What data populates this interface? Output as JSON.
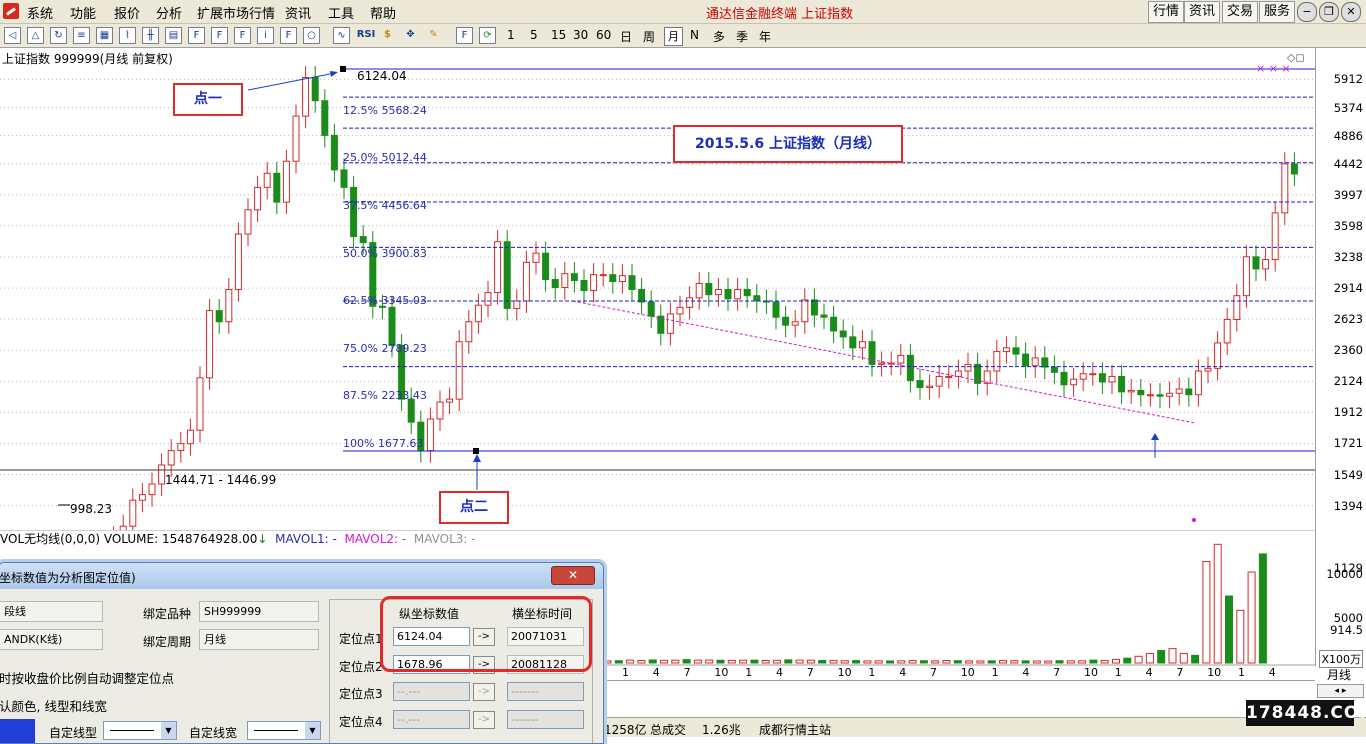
{
  "menubar": {
    "items": [
      "系统",
      "功能",
      "报价",
      "分析",
      "扩展市场行情",
      "资讯",
      "工具",
      "帮助"
    ],
    "app_title": "通达信金融终端   上证指数",
    "right_buttons": [
      "行情",
      "资讯",
      "交易",
      "服务"
    ]
  },
  "toolbar": {
    "icons": [
      "back-icon",
      "up-icon",
      "refresh-icon",
      "list-icon",
      "grid-icon",
      "line-chart-icon",
      "kline-icon",
      "report-icon",
      "f10-icon",
      "f11-icon",
      "fiz-icon",
      "info-icon",
      "search-icon",
      "wave-icon",
      "rsi-icon",
      "money-icon",
      "move-icon",
      "pencil-icon",
      "f5-icon",
      "cycle-icon"
    ],
    "periods": [
      "1",
      "5",
      "15",
      "30",
      "60",
      "日",
      "周",
      "月",
      "N",
      "多",
      "季",
      "年"
    ],
    "selected_period": "月"
  },
  "chart": {
    "title": "上证指数 999999(月线 前复权)",
    "price_ticks": [
      "5912",
      "5374",
      "4886",
      "4442",
      "3997",
      "3598",
      "3238",
      "2914",
      "2623",
      "2360",
      "2124",
      "1912",
      "1721",
      "1549",
      "1394",
      "1129",
      "914.5"
    ],
    "fib_labels": [
      "12.5% 5568.24",
      "25.0% 5012.44",
      "37.5% 4456.64",
      "50.0% 3900.83",
      "62.5% 3345.03",
      "75.0% 2789.23",
      "87.5% 2233.43",
      "100% 1677.63"
    ],
    "annotations": {
      "high_label": "6124.04",
      "range_label": "1444.71 - 1446.99",
      "low_label": "998.23",
      "note1": "点一",
      "note2": "点二",
      "title_note": "2015.5.6  上证指数（月线）"
    }
  },
  "volume": {
    "info": "VOL无均线(0,0,0)  VOLUME: 1548764928.00",
    "arrow": "↓",
    "mavol1": "MAVOL1: -",
    "mavol2": "MAVOL2: -",
    "mavol3": "MAVOL3: -",
    "ticks": [
      "10000",
      "5000"
    ],
    "unit": "X100万",
    "x_ticks": [
      "1",
      "4",
      "7",
      "10",
      "1",
      "4",
      "7",
      "10",
      "1",
      "4",
      "7",
      "10",
      "1",
      "4",
      "7",
      "10",
      "1",
      "4",
      "7",
      "10",
      "1",
      "4"
    ],
    "period_label": "月线"
  },
  "dialog": {
    "title": "坐标数值为分析图定位值)",
    "close": "✕",
    "line_type_label": "段线",
    "bind_symbol_label": "绑定品种",
    "bind_symbol_value": "SH999999",
    "kline_label": "ANDK(K线)",
    "bind_period_label": "绑定周期",
    "bind_period_value": "月线",
    "auto_adjust_label": "时按收盘价比例自动调整定位点",
    "default_style_label": "认颜色, 线型和线宽",
    "custom_line_type_label": "自定线型",
    "custom_line_width_label": "自定线宽",
    "col_header_value": "纵坐标数值",
    "col_header_time": "横坐标时间",
    "points": [
      {
        "label": "定位点1",
        "value": "6124.04",
        "time": "20071031"
      },
      {
        "label": "定位点2",
        "value": "1678.96",
        "time": "20081128"
      },
      {
        "label": "定位点3",
        "value": "--.---",
        "time": "-------"
      },
      {
        "label": "定位点4",
        "value": "--.---",
        "time": "-------"
      }
    ],
    "arrow_label": "->"
  },
  "status": {
    "amount": "1258亿",
    "total_label": "总成交",
    "total_value": "1.26兆",
    "station": "成都行情主站"
  },
  "watermark": "178448.COM"
}
